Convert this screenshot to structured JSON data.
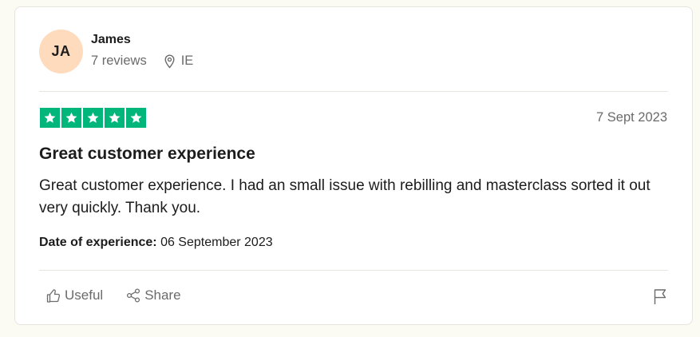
{
  "review": {
    "avatar_initials": "JA",
    "avatar_color": "#ffdbbd",
    "name": "James",
    "review_count": "7 reviews",
    "location": "IE",
    "rating": 5,
    "star_color": "#00b67a",
    "date": "7 Sept 2023",
    "title": "Great customer experience",
    "body": "Great customer experience. I had an small issue with rebilling and masterclass sorted it out very quickly. Thank you.",
    "experience_label": "Date of experience:",
    "experience_date": "06 September 2023"
  },
  "actions": {
    "useful_label": "Useful",
    "share_label": "Share",
    "useful_icon": "thumbs-up-icon",
    "share_icon": "share-icon",
    "flag_icon": "flag-icon"
  }
}
